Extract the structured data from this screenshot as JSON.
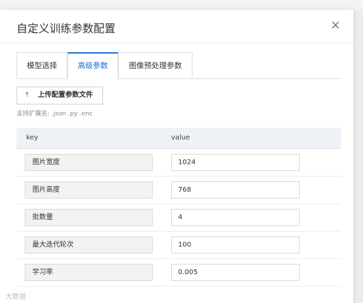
{
  "dialog": {
    "title": "自定义训练参数配置",
    "close_glyph": "×"
  },
  "tabs": [
    {
      "label": "模型选择",
      "active": false
    },
    {
      "label": "高级参数",
      "active": true
    },
    {
      "label": "图像预处理参数",
      "active": false
    }
  ],
  "upload": {
    "icon": "upload-icon",
    "icon_glyph": "⤒",
    "label": "上传配置参数文件"
  },
  "hint": "支持扩展名: .json .py .enc",
  "table": {
    "headers": {
      "key": "key",
      "value": "value"
    },
    "rows": [
      {
        "key": "图片宽度",
        "value": "1024"
      },
      {
        "key": "图片高度",
        "value": "768"
      },
      {
        "key": "批数量",
        "value": "4"
      },
      {
        "key": "最大迭代轮次",
        "value": "100"
      },
      {
        "key": "学习率",
        "value": "0.005"
      }
    ]
  },
  "watermark": "大数据",
  "colors": {
    "accent": "#1a6fd3",
    "header_bg": "#eef1f6",
    "key_bg": "#f2f2f2"
  }
}
